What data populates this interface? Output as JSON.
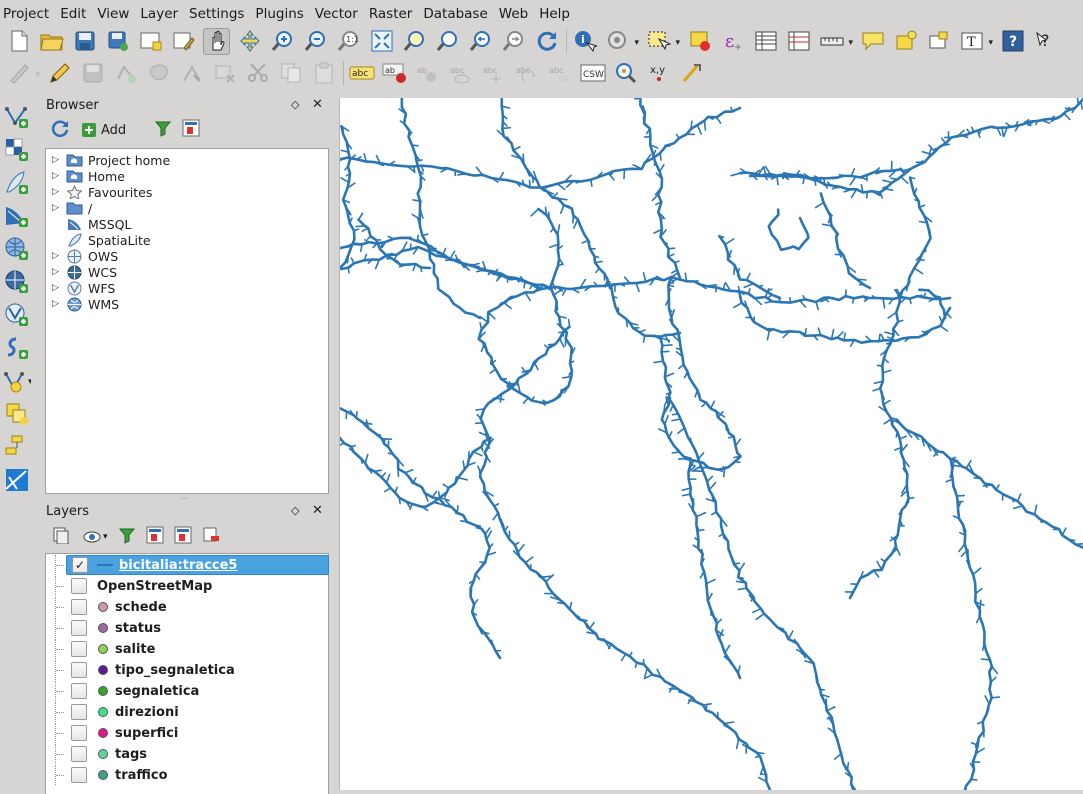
{
  "menu": [
    "Project",
    "Edit",
    "View",
    "Layer",
    "Settings",
    "Plugins",
    "Vector",
    "Raster",
    "Database",
    "Web",
    "Help"
  ],
  "browser": {
    "title": "Browser",
    "add_label": "Add",
    "items": [
      {
        "label": "Project home",
        "icon": "folder-home-icon",
        "expandable": true
      },
      {
        "label": "Home",
        "icon": "folder-home-icon",
        "expandable": true
      },
      {
        "label": "Favourites",
        "icon": "star-icon",
        "expandable": true
      },
      {
        "label": "/",
        "icon": "folder-icon",
        "expandable": true
      },
      {
        "label": "MSSQL",
        "icon": "mssql-icon",
        "expandable": false
      },
      {
        "label": "SpatiaLite",
        "icon": "spatialite-feather-icon",
        "expandable": false
      },
      {
        "label": "OWS",
        "icon": "globe-icon",
        "expandable": true
      },
      {
        "label": "WCS",
        "icon": "wcs-globe-icon",
        "expandable": true
      },
      {
        "label": "WFS",
        "icon": "wfs-globe-icon",
        "expandable": true
      },
      {
        "label": "WMS",
        "icon": "wms-globe-icon",
        "expandable": true
      }
    ]
  },
  "layers": {
    "title": "Layers",
    "items": [
      {
        "label": "bicitalia:tracce5",
        "checked": true,
        "selected": true,
        "symbol": "line",
        "color": "#2a78b7"
      },
      {
        "label": "OpenStreetMap",
        "checked": false,
        "selected": false,
        "symbol": "none",
        "color": ""
      },
      {
        "label": "schede",
        "checked": false,
        "selected": false,
        "symbol": "point",
        "color": "#c99aa8"
      },
      {
        "label": "status",
        "checked": false,
        "selected": false,
        "symbol": "point",
        "color": "#a06aa0"
      },
      {
        "label": "salite",
        "checked": false,
        "selected": false,
        "symbol": "point",
        "color": "#8fd24f"
      },
      {
        "label": "tipo_segnaletica",
        "checked": false,
        "selected": false,
        "symbol": "point",
        "color": "#5a1a90"
      },
      {
        "label": "segnaletica",
        "checked": false,
        "selected": false,
        "symbol": "point",
        "color": "#3aa032"
      },
      {
        "label": "direzioni",
        "checked": false,
        "selected": false,
        "symbol": "point",
        "color": "#3ce38f"
      },
      {
        "label": "superfici",
        "checked": false,
        "selected": false,
        "symbol": "point",
        "color": "#e0158f"
      },
      {
        "label": "tags",
        "checked": false,
        "selected": false,
        "symbol": "point",
        "color": "#5ed39c"
      },
      {
        "label": "traffico",
        "checked": false,
        "selected": false,
        "symbol": "point",
        "color": "#3f9f88"
      }
    ]
  },
  "toolbar_text": {
    "csv": "CSW",
    "xy": "x,y",
    "abc": "abc"
  },
  "colors": {
    "track": "#2b76b3",
    "selection": "#4aa3e0"
  }
}
